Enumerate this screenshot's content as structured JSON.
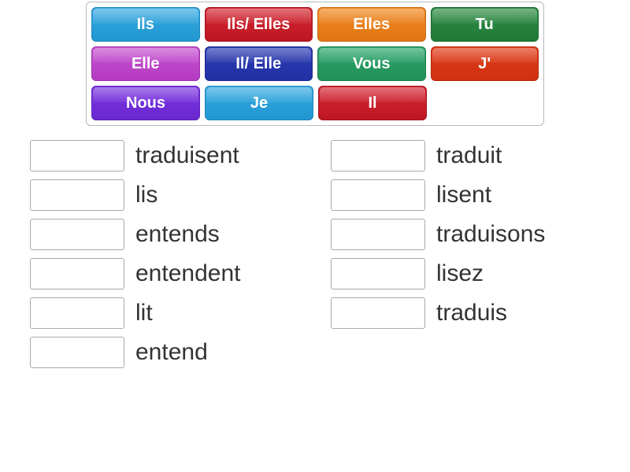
{
  "tiles": [
    {
      "label": "Ils",
      "colorClass": "blue-lt"
    },
    {
      "label": "Ils/ Elles",
      "colorClass": "red-dk"
    },
    {
      "label": "Elles",
      "colorClass": "orange"
    },
    {
      "label": "Tu",
      "colorClass": "green-dk"
    },
    {
      "label": "Elle",
      "colorClass": "magenta"
    },
    {
      "label": "Il/ Elle",
      "colorClass": "blue-dk"
    },
    {
      "label": "Vous",
      "colorClass": "teal"
    },
    {
      "label": "J'",
      "colorClass": "red-or"
    },
    {
      "label": "Nous",
      "colorClass": "purple"
    },
    {
      "label": "Je",
      "colorClass": "sky"
    },
    {
      "label": "Il",
      "colorClass": "red-md"
    }
  ],
  "answers": {
    "left": [
      "traduisent",
      "lis",
      "entends",
      "entendent",
      "lit",
      "entend"
    ],
    "right": [
      "traduit",
      "lisent",
      "traduisons",
      "lisez",
      "traduis"
    ]
  }
}
